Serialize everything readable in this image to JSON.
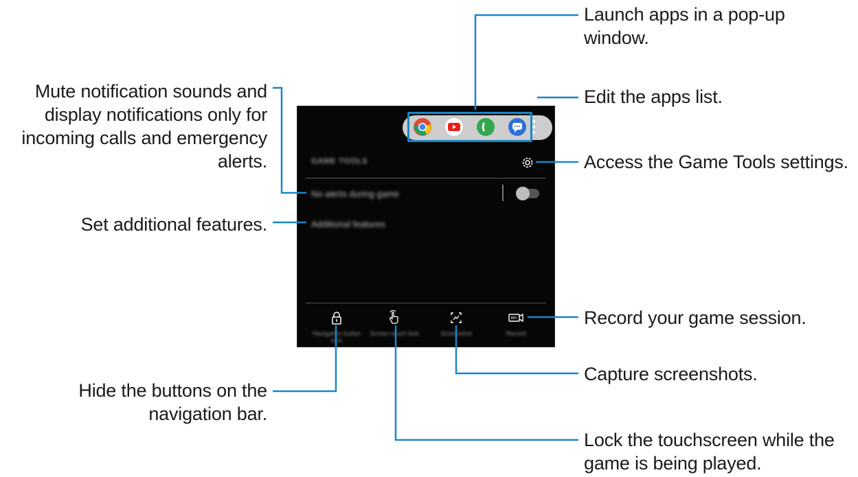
{
  "callouts": {
    "popup_apps": "Launch apps in a pop-up\nwindow.",
    "edit_apps": "Edit the apps list.",
    "settings": "Access the Game Tools settings.",
    "mute": "Mute notification sounds and\ndisplay notifications only for\nincoming calls and emergency\nalerts.",
    "additional": "Set additional features.",
    "record": "Record your game session.",
    "screenshot": "Capture screenshots.",
    "nav_bar": "Hide the buttons on the\nnavigation bar.",
    "lock_touch": "Lock the touchscreen while the\ngame is being played."
  },
  "screen": {
    "apps": [
      {
        "name": "chrome-icon",
        "color": "#dd4b39"
      },
      {
        "name": "youtube-icon",
        "color": "#e62117"
      },
      {
        "name": "phone-icon",
        "color": "#2fa84f"
      },
      {
        "name": "messages-icon",
        "color": "#2f6fd6"
      }
    ],
    "title_blurred": "GAME TOOLS",
    "row1_blurred": "No alerts during game",
    "row2_blurred": "Additional features",
    "no_alerts_enabled": false,
    "bottom": [
      {
        "icon": "lock-icon",
        "label": "Navigation button lock"
      },
      {
        "icon": "touch-lock-icon",
        "label": "Screen touch lock"
      },
      {
        "icon": "screenshot-icon",
        "label": "Screenshot"
      },
      {
        "icon": "record-icon",
        "label": "Record"
      }
    ]
  },
  "colors": {
    "leader": "#1a86c8",
    "screen": "#060606",
    "text": "#1a1a1a"
  }
}
